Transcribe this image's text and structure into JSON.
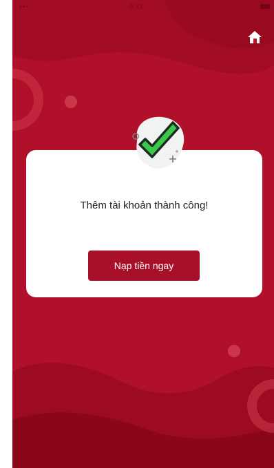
{
  "status_bar": {
    "left_text": "••• ",
    "time": "9:41"
  },
  "header": {
    "home_icon": "home-icon"
  },
  "success_card": {
    "icon": "check-icon",
    "message": "Thêm tài khoản thành công!",
    "topup_button_label": "Nạp tiền ngay"
  },
  "colors": {
    "background": "#b0102a",
    "button": "#a8102a",
    "check_green": "#3cc84a"
  }
}
